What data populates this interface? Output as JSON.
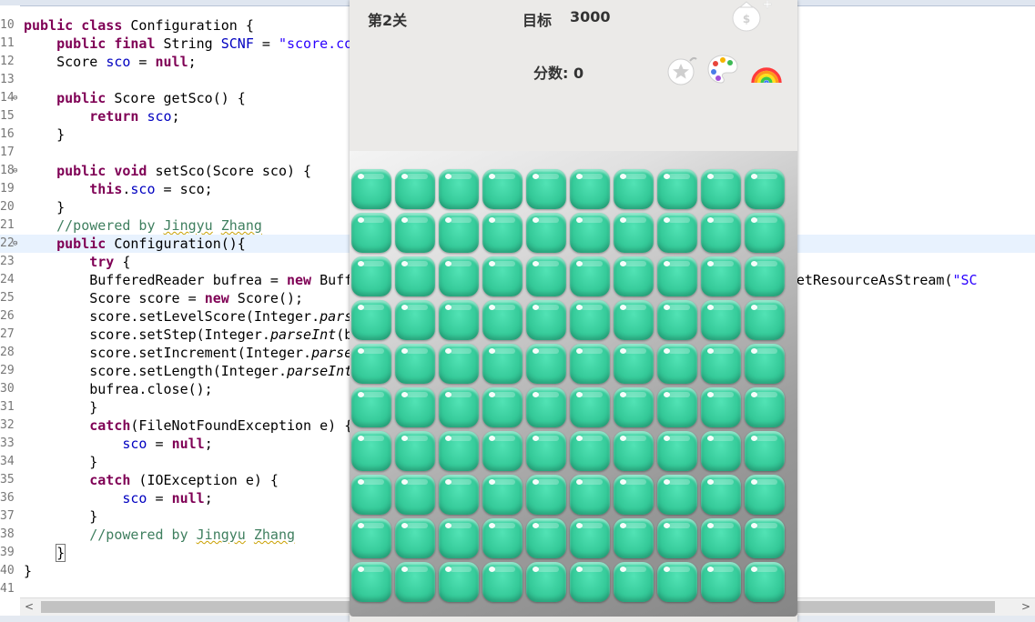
{
  "editor": {
    "lines": [
      {
        "num": "10",
        "fold": "",
        "html": "<span class=\"kw\">public</span> <span class=\"kw\">class</span> Configuration {"
      },
      {
        "num": "11",
        "fold": "",
        "html": "    <span class=\"kw\">public</span> <span class=\"kw\">final</span> String <span class=\"fld\">SCNF</span> = <span class=\"str\">\"score.co</span>"
      },
      {
        "num": "12",
        "fold": "",
        "html": "    Score <span class=\"fld\">sco</span> = <span class=\"kw\">null</span>;"
      },
      {
        "num": "13",
        "fold": "",
        "html": ""
      },
      {
        "num": "14",
        "fold": "⊖",
        "html": "    <span class=\"kw\">public</span> Score getSco() {"
      },
      {
        "num": "15",
        "fold": "",
        "html": "        <span class=\"kw\">return</span> <span class=\"fld\">sco</span>;"
      },
      {
        "num": "16",
        "fold": "",
        "html": "    }"
      },
      {
        "num": "17",
        "fold": "",
        "html": ""
      },
      {
        "num": "18",
        "fold": "⊖",
        "html": "    <span class=\"kw\">public</span> <span class=\"kw\">void</span> setSco(Score sco) {"
      },
      {
        "num": "19",
        "fold": "",
        "html": "        <span class=\"kw\">this</span>.<span class=\"fld\">sco</span> = sco;"
      },
      {
        "num": "20",
        "fold": "",
        "html": "    }"
      },
      {
        "num": "21",
        "fold": "",
        "html": "    <span class=\"cmt\">//powered by <span class=\"sq\">Jingyu</span> <span class=\"sq\">Zhang</span></span>"
      },
      {
        "num": "22",
        "fold": "⊖",
        "html": "    <span class=\"kw\">public</span> Configuration(){",
        "current": true
      },
      {
        "num": "23",
        "fold": "",
        "html": "        <span class=\"kw\">try</span> {"
      },
      {
        "num": "24",
        "fold": "",
        "html": "        BufferedReader bufrea = <span class=\"kw\">new</span> Buff                                              ader().getResourceAsStream(<span class=\"str\">\"SC</span>"
      },
      {
        "num": "25",
        "fold": "",
        "html": "        Score score = <span class=\"kw\">new</span> Score();"
      },
      {
        "num": "26",
        "fold": "",
        "html": "        score.setLevelScore(Integer.<span class=\"ital\">parse</span>"
      },
      {
        "num": "27",
        "fold": "",
        "html": "        score.setStep(Integer.<span class=\"ital\">parseInt</span>(b"
      },
      {
        "num": "28",
        "fold": "",
        "html": "        score.setIncrement(Integer.<span class=\"ital\">parse</span>"
      },
      {
        "num": "29",
        "fold": "",
        "html": "        score.setLength(Integer.<span class=\"ital\">parseInt</span>"
      },
      {
        "num": "30",
        "fold": "",
        "html": "        bufrea.close();"
      },
      {
        "num": "31",
        "fold": "",
        "html": "        }"
      },
      {
        "num": "32",
        "fold": "",
        "html": "        <span class=\"kw\">catch</span>(FileNotFoundException e) {"
      },
      {
        "num": "33",
        "fold": "",
        "html": "            <span class=\"fld\">sco</span> = <span class=\"kw\">null</span>;"
      },
      {
        "num": "34",
        "fold": "",
        "html": "        }"
      },
      {
        "num": "35",
        "fold": "",
        "html": "        <span class=\"kw\">catch</span> (IOException e) {"
      },
      {
        "num": "36",
        "fold": "",
        "html": "            <span class=\"fld\">sco</span> = <span class=\"kw\">null</span>;"
      },
      {
        "num": "37",
        "fold": "",
        "html": "        }"
      },
      {
        "num": "38",
        "fold": "",
        "html": "        <span class=\"cmt\">//powered by <span class=\"sq\">Jingyu</span> <span class=\"sq\">Zhang</span></span>"
      },
      {
        "num": "39",
        "fold": "",
        "html": "    <span style=\"outline:1px solid #777\">}</span>"
      },
      {
        "num": "40",
        "fold": "",
        "html": "}"
      },
      {
        "num": "41",
        "fold": "",
        "html": ""
      }
    ]
  },
  "game": {
    "level_label": "第2关",
    "target_label": "目标",
    "target_value": "3000",
    "score_label": "分数: 0",
    "props": [
      "money-bag-plus-icon",
      "star-bomb-icon",
      "color-palette-icon",
      "rainbow-icon"
    ],
    "board": {
      "rows": 10,
      "cols": 10,
      "tile": "green-candy"
    }
  },
  "scrollbar": {
    "left_arrow": "<",
    "right_arrow": ">"
  }
}
